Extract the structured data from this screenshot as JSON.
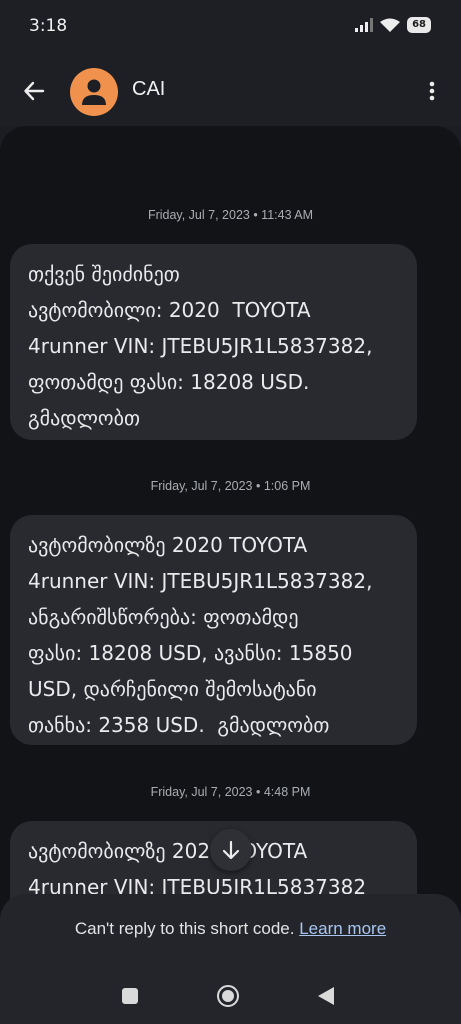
{
  "status_bar": {
    "time": "3:18",
    "battery": "68"
  },
  "header": {
    "contact_name": "CAI"
  },
  "messages": [
    {
      "timestamp": "Friday, Jul 7, 2023 • 11:43 AM",
      "text": "თქვენ შეიძინეთ\nავტომობილი: 2020  TOYOTA\n4runner VIN: JTEBU5JR1L5837382,\nფოთამდე ფასი: 18208 USD.\nგმადლობთ"
    },
    {
      "timestamp": "Friday, Jul 7, 2023 • 1:06 PM",
      "text": "ავტომობილზე 2020 TOYOTA\n4runner VIN: JTEBU5JR1L5837382,\nანგარიშსწორება: ფოთამდე\nფასი: 18208 USD, ავანსი: 15850\nUSD, დარჩენილი შემოსატანი\nთანხა: 2358 USD.  გმადლობთ"
    },
    {
      "timestamp": "Friday, Jul 7, 2023 • 4:48 PM",
      "text": "ავტომობილზე 2020 TOYOTA\n4runner VIN: JTEBU5JR1L5837382"
    }
  ],
  "reply": {
    "notice": "Can't reply to this short code.",
    "link": "Learn more"
  },
  "colors": {
    "avatar": "#f0924e",
    "link": "#a8c6f0",
    "bubble": "#282a30",
    "background": "#121316"
  },
  "icons": {
    "back": "arrow-left-icon",
    "avatar": "person-icon",
    "menu": "more-vert-icon",
    "scroll": "arrow-down-icon"
  }
}
